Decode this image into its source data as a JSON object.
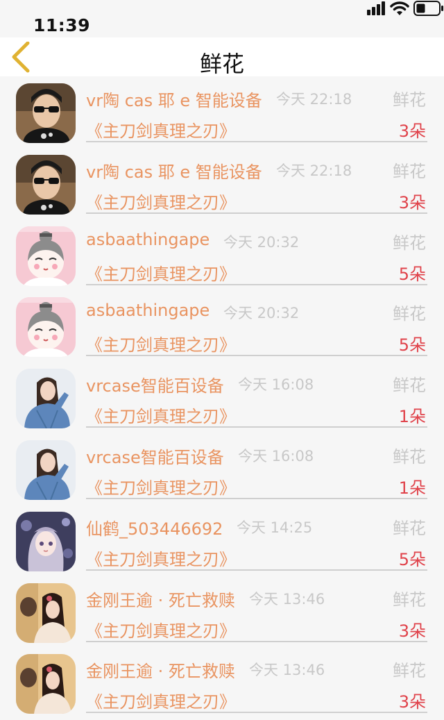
{
  "status_bar": {
    "time": "11:39"
  },
  "nav": {
    "title": "鲜花"
  },
  "records": [
    {
      "avatar": "man-sunglasses",
      "user": "vr陶 cas 耶 e 智能设备",
      "time": "今天 22:18",
      "gift_type": "鲜花",
      "novel": "《主刀剑真理之刃》",
      "count": "3朵"
    },
    {
      "avatar": "man-sunglasses",
      "user": "vr陶 cas 耶 e 智能设备",
      "time": "今天 22:18",
      "gift_type": "鲜花",
      "novel": "《主刀剑真理之刃》",
      "count": "3朵"
    },
    {
      "avatar": "cartoon-girl",
      "user": "asbaathingape",
      "time": "今天 20:32",
      "gift_type": "鲜花",
      "novel": "《主刀剑真理之刃》",
      "count": "5朵"
    },
    {
      "avatar": "cartoon-girl",
      "user": "asbaathingape",
      "time": "今天 20:32",
      "gift_type": "鲜花",
      "novel": "《主刀剑真理之刃》",
      "count": "5朵"
    },
    {
      "avatar": "girl-denim",
      "user": "vrcase智能百设备",
      "time": "今天 16:08",
      "gift_type": "鲜花",
      "novel": "《主刀剑真理之刃》",
      "count": "1朵"
    },
    {
      "avatar": "girl-denim",
      "user": "vrcase智能百设备",
      "time": "今天 16:08",
      "gift_type": "鲜花",
      "novel": "《主刀剑真理之刃》",
      "count": "1朵"
    },
    {
      "avatar": "anime-girl",
      "user": "仙鹤_503446692",
      "time": "今天 14:25",
      "gift_type": "鲜花",
      "novel": "《主刀剑真理之刃》",
      "count": "5朵"
    },
    {
      "avatar": "girl-warm",
      "user": "金刚王逾 · 死亡救赎",
      "time": "今天 13:46",
      "gift_type": "鲜花",
      "novel": "《主刀剑真理之刃》",
      "count": "3朵"
    },
    {
      "avatar": "girl-warm",
      "user": "金刚王逾 · 死亡救赎",
      "time": "今天 13:46",
      "gift_type": "鲜花",
      "novel": "《主刀剑真理之刃》",
      "count": "3朵"
    }
  ]
}
